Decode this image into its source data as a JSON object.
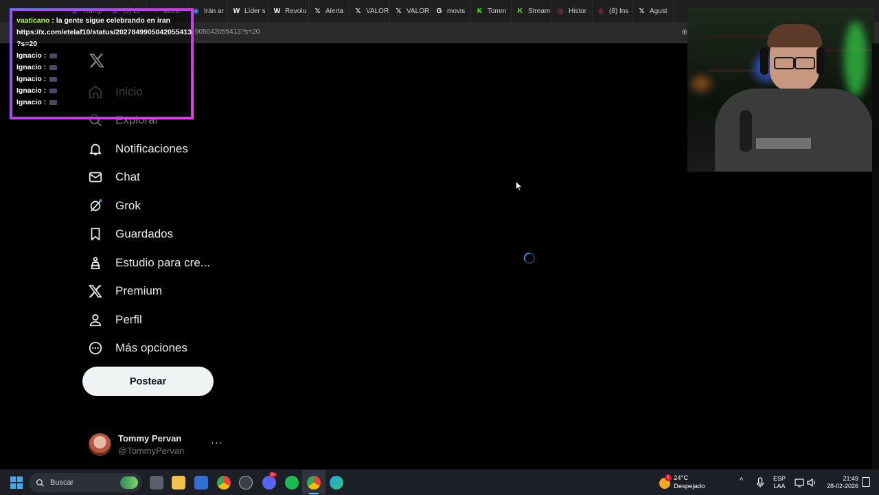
{
  "browser": {
    "tabs": [
      {
        "label": "Trump",
        "icon": "twitch-icon",
        "color": "#7b61ff"
      },
      {
        "label": "(6) Et",
        "icon": "twitch-icon",
        "color": "#9146ff"
      },
      {
        "label": "Munc",
        "icon": "web-icon",
        "color": "#9aa0a6"
      },
      {
        "label": "Irán ar",
        "icon": "globe-icon",
        "color": "#4c8bf5"
      },
      {
        "label": "Líder s",
        "icon": "wikipedia-icon",
        "color": "#ffffff"
      },
      {
        "label": "Revolu",
        "icon": "wikipedia-icon",
        "color": "#ffffff"
      },
      {
        "label": "Alerta",
        "icon": "x-icon",
        "color": "#ffffff"
      },
      {
        "label": "VALOR",
        "icon": "x-icon",
        "color": "#ffffff"
      },
      {
        "label": "VALOR",
        "icon": "x-icon",
        "color": "#ffffff"
      },
      {
        "label": "movis",
        "icon": "google-icon",
        "color": "#ffffff"
      },
      {
        "label": "Tomm",
        "icon": "kick-icon",
        "color": "#53fc18"
      },
      {
        "label": "Stream",
        "icon": "kick-icon",
        "color": "#53fc18"
      },
      {
        "label": "Histor",
        "icon": "instagram-icon",
        "color": "#e1306c"
      },
      {
        "label": "(8) Ins",
        "icon": "instagram-icon",
        "color": "#e1306c"
      },
      {
        "label": "Agust",
        "icon": "x-icon",
        "color": "#ffffff"
      }
    ],
    "url": "9050420554​13?s=20"
  },
  "nav": {
    "items": [
      {
        "label": "Inicio",
        "icon": "home-icon",
        "name": "nav-home"
      },
      {
        "label": "Explorar",
        "icon": "search-icon",
        "name": "nav-explore"
      },
      {
        "label": "Notificaciones",
        "icon": "bell-icon",
        "name": "nav-notifications"
      },
      {
        "label": "Chat",
        "icon": "mail-icon",
        "name": "nav-chat"
      },
      {
        "label": "Grok",
        "icon": "grok-icon",
        "name": "nav-grok"
      },
      {
        "label": "Guardados",
        "icon": "bookmark-icon",
        "name": "nav-bookmarks"
      },
      {
        "label": "Estudio para cre...",
        "icon": "creator-studio-icon",
        "name": "nav-creator-studio"
      },
      {
        "label": "Premium",
        "icon": "x-icon",
        "name": "nav-premium"
      },
      {
        "label": "Perfil",
        "icon": "person-icon",
        "name": "nav-profile"
      },
      {
        "label": "Más opciones",
        "icon": "more-circle-icon",
        "name": "nav-more"
      }
    ],
    "post_label": "Postear"
  },
  "account": {
    "name": "Tommy Pervan",
    "handle": "@TommyPervan",
    "more": "···"
  },
  "chat_overlay": {
    "messages": [
      {
        "user": "vaaticano",
        "text": "la gente sigue celebrando en iran",
        "user_color": "#b7ff3a"
      },
      {
        "user": "",
        "text": "https://x.com/etelaf10/status/2027849905042055413",
        "user_color": "#ffffff"
      },
      {
        "user": "",
        "text": "?s=20",
        "user_color": "#ffffff"
      },
      {
        "user": "Ignacio",
        "text": "",
        "user_color": "#ffffff"
      },
      {
        "user": "Ignacio",
        "text": "",
        "user_color": "#ffffff"
      },
      {
        "user": "Ignacio",
        "text": "",
        "user_color": "#ffffff"
      },
      {
        "user": "Ignacio",
        "text": "",
        "user_color": "#ffffff"
      },
      {
        "user": "Ignacio",
        "text": "",
        "user_color": "#ffffff"
      }
    ]
  },
  "taskbar": {
    "search_placeholder": "Buscar",
    "weather_temp": "24°C",
    "weather_desc": "Despejado",
    "weather_badge": "1",
    "lang_top": "ESP",
    "lang_bottom": "LAA",
    "time": "21:49",
    "date": "28-02-2026",
    "discord_badge": "9+"
  },
  "colors": {
    "x_bg": "#000000",
    "x_text": "#e7e9ea",
    "x_muted": "#71767b",
    "post_button": "#eff3f4",
    "spinner": "#1d9bf0",
    "chat_border": "#c83cf0"
  }
}
